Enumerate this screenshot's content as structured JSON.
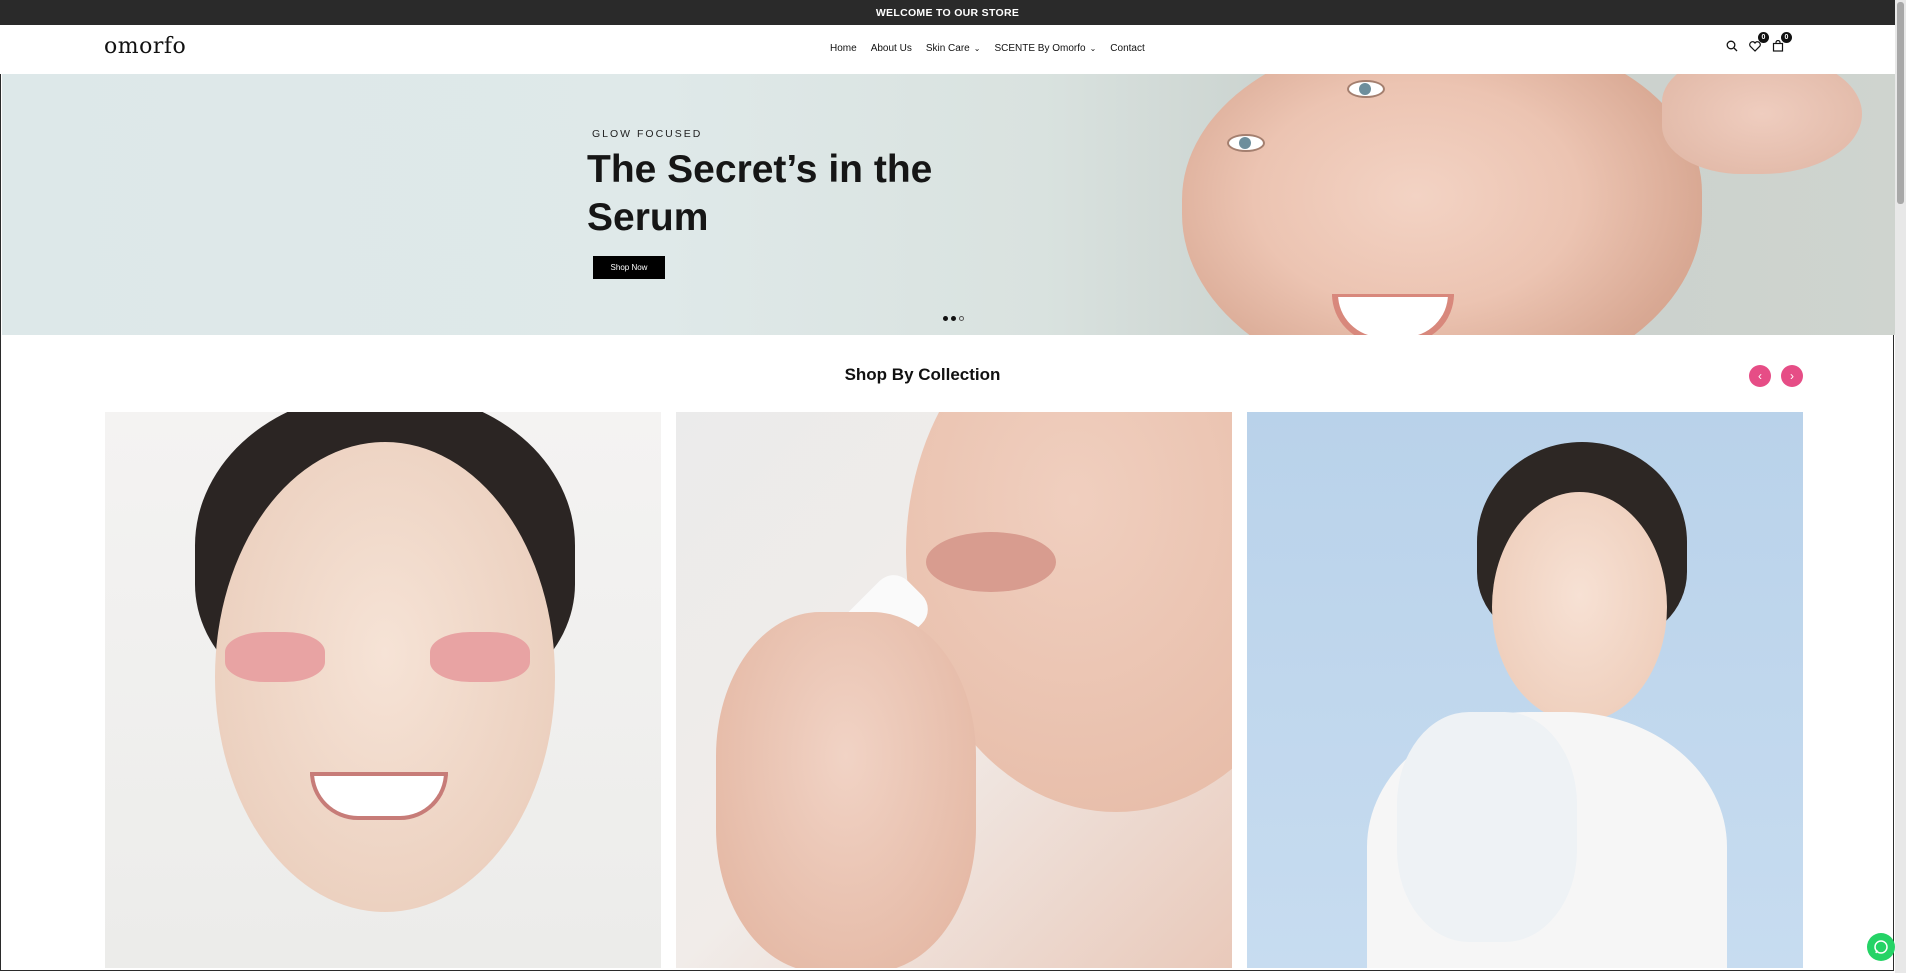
{
  "announcement": {
    "text": "WELCOME TO OUR STORE"
  },
  "header": {
    "logo": "omorfo",
    "nav": [
      {
        "label": "Home",
        "has_dropdown": false
      },
      {
        "label": "About Us",
        "has_dropdown": false
      },
      {
        "label": "Skin Care",
        "has_dropdown": true
      },
      {
        "label": "SCENTE By Omorfo",
        "has_dropdown": true
      },
      {
        "label": "Contact",
        "has_dropdown": false
      }
    ],
    "icons": [
      "search-icon",
      "heart-icon",
      "cart-icon"
    ],
    "wishlist_count": "0",
    "cart_count": "0"
  },
  "hero": {
    "eyebrow": "GLOW FOCUSED",
    "title": "The Secret’s in the Serum",
    "button_label": "Shop Now",
    "slides_total": 3,
    "active_slide": 1
  },
  "collections": {
    "title": "Shop By Collection",
    "prev_icon": "chevron-left-icon",
    "next_icon": "chevron-right-icon",
    "accent_color": "#e64d86"
  },
  "colors": {
    "topbar": "#2a2a2a",
    "button": "#000000",
    "whatsapp": "#25d366"
  }
}
